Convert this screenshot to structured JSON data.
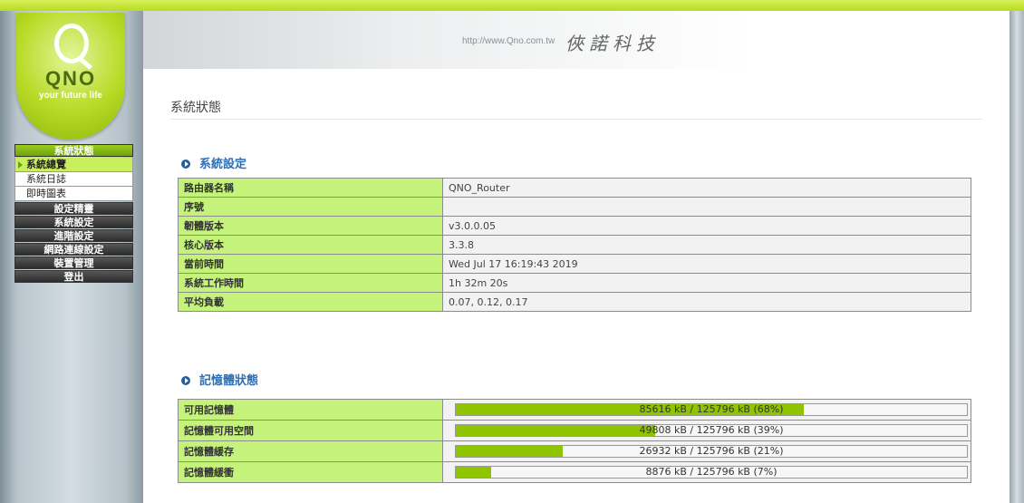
{
  "header": {
    "url": "http://www.Qno.com.tw",
    "company": "俠諾科技"
  },
  "logo": {
    "brand": "QNO",
    "slogan": "your future life"
  },
  "menu": {
    "items": [
      {
        "label": "系統狀態",
        "active": true
      },
      {
        "label": "設定精靈"
      },
      {
        "label": "系統設定"
      },
      {
        "label": "進階設定"
      },
      {
        "label": "網路連線設定"
      },
      {
        "label": "裝置管理"
      },
      {
        "label": "登出"
      }
    ],
    "sub_items": [
      {
        "label": "系統總覽",
        "selected": true
      },
      {
        "label": "系統日誌"
      },
      {
        "label": "即時圖表"
      }
    ]
  },
  "page": {
    "title": "系統狀態"
  },
  "system_settings": {
    "title": "系統設定",
    "rows": [
      {
        "label": "路由器名稱",
        "value": "QNO_Router"
      },
      {
        "label": "序號",
        "value": ""
      },
      {
        "label": "韌體版本",
        "value": "v3.0.0.05"
      },
      {
        "label": "核心版本",
        "value": "3.3.8"
      },
      {
        "label": "當前時間",
        "value": "Wed Jul 17 16:19:43 2019"
      },
      {
        "label": "系統工作時間",
        "value": "1h 32m 20s"
      },
      {
        "label": "平均負載",
        "value": "0.07, 0.12, 0.17"
      }
    ]
  },
  "memory_status": {
    "title": "記憶體狀態",
    "rows": [
      {
        "label": "可用記憶體",
        "text": "85616 kB / 125796 kB (68%)",
        "percent": 68
      },
      {
        "label": "記憶體可用空間",
        "text": "49808 kB / 125796 kB (39%)",
        "percent": 39
      },
      {
        "label": "記憶體緩存",
        "text": "26932 kB / 125796 kB (21%)",
        "percent": 21
      },
      {
        "label": "記憶體緩衝",
        "text": "8876 kB / 125796 kB (7%)",
        "percent": 7
      }
    ]
  },
  "colors": {
    "accent_green": "#8fc400",
    "label_green": "#c4f27a",
    "section_blue": "#2c6fb6"
  }
}
